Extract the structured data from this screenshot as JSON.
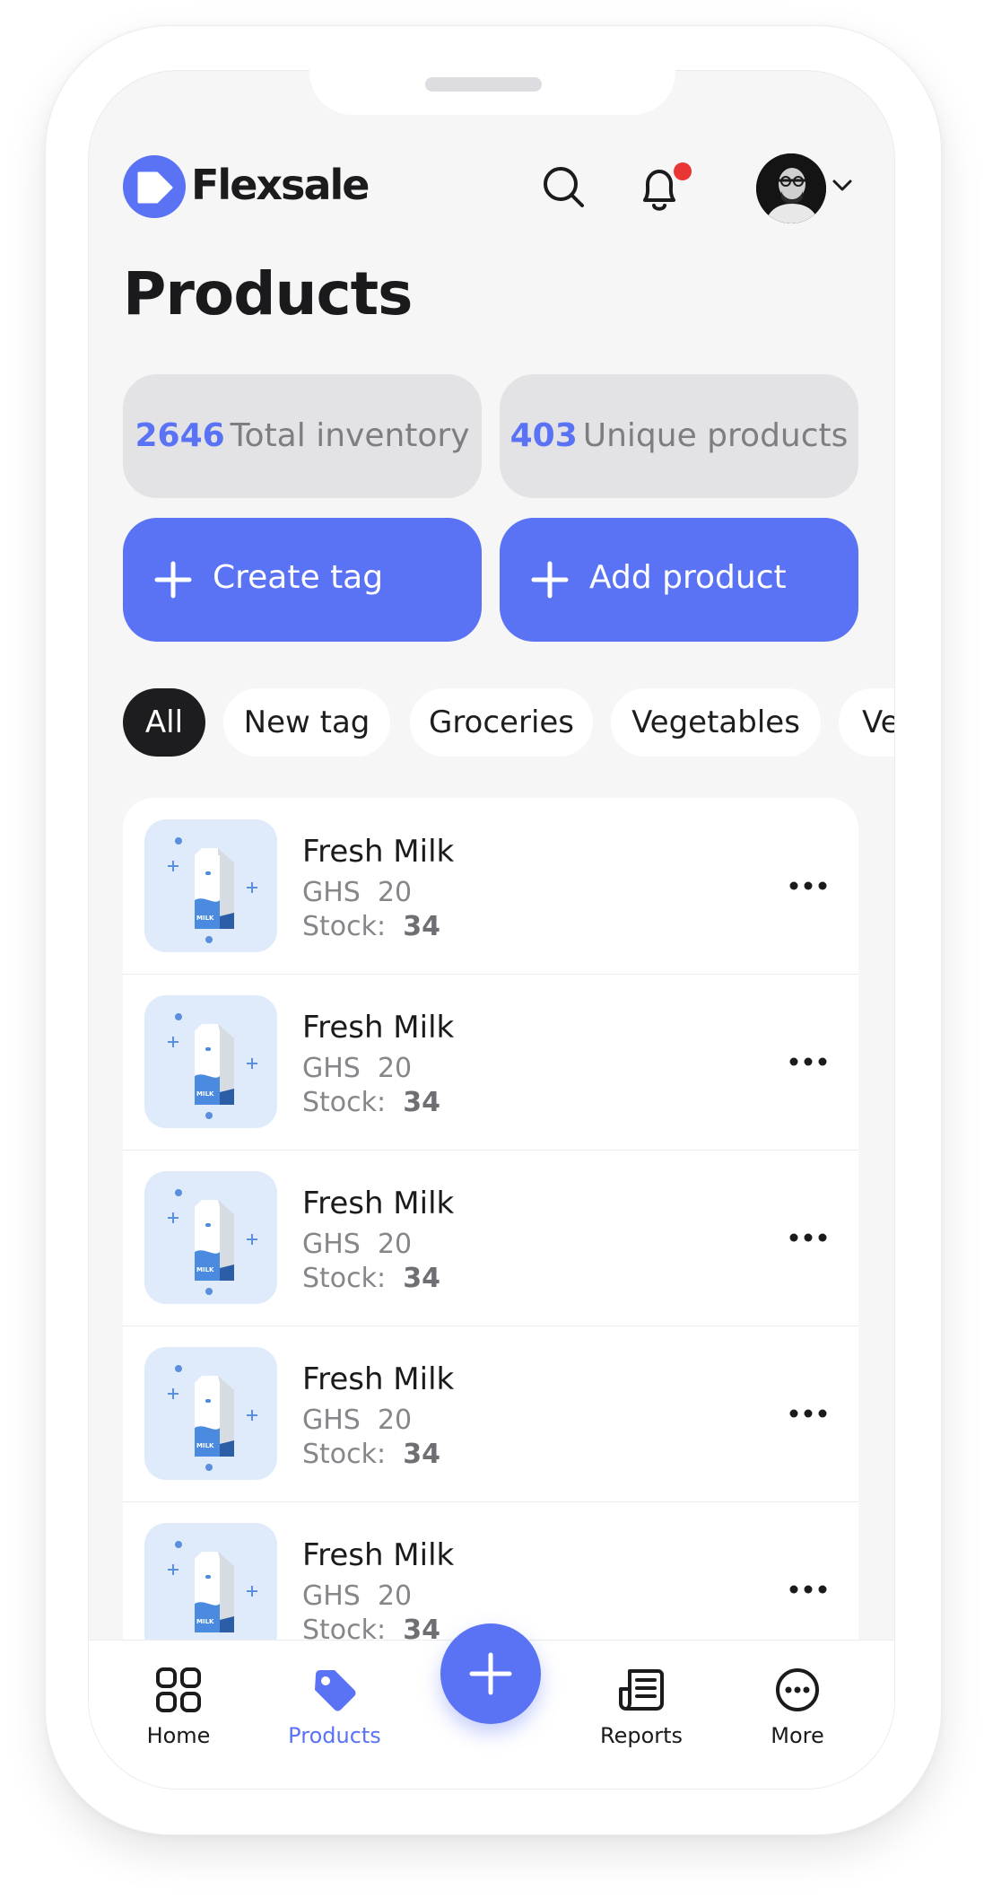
{
  "app": {
    "name": "Flexsale"
  },
  "header": {
    "title": "Products"
  },
  "stats": [
    {
      "value": "2646",
      "label": "Total inventory"
    },
    {
      "value": "403",
      "label": "Unique products"
    }
  ],
  "actions": {
    "create_tag": "Create tag",
    "add_product": "Add product"
  },
  "tags": [
    "All",
    "New tag",
    "Groceries",
    "Vegetables",
    "Ve"
  ],
  "products": [
    {
      "name": "Fresh Milk",
      "currency": "GHS",
      "price": "20",
      "stock_label": "Stock:",
      "stock": "34"
    },
    {
      "name": "Fresh Milk",
      "currency": "GHS",
      "price": "20",
      "stock_label": "Stock:",
      "stock": "34"
    },
    {
      "name": "Fresh Milk",
      "currency": "GHS",
      "price": "20",
      "stock_label": "Stock:",
      "stock": "34"
    },
    {
      "name": "Fresh Milk",
      "currency": "GHS",
      "price": "20",
      "stock_label": "Stock:",
      "stock": "34"
    },
    {
      "name": "Fresh Milk",
      "currency": "GHS",
      "price": "20",
      "stock_label": "Stock:",
      "stock": "34"
    }
  ],
  "nav": {
    "home": "Home",
    "products": "Products",
    "reports": "Reports",
    "more": "More"
  },
  "colors": {
    "accent": "#5a72f4",
    "dark": "#1d1d1f",
    "notification": "#ea3535"
  }
}
